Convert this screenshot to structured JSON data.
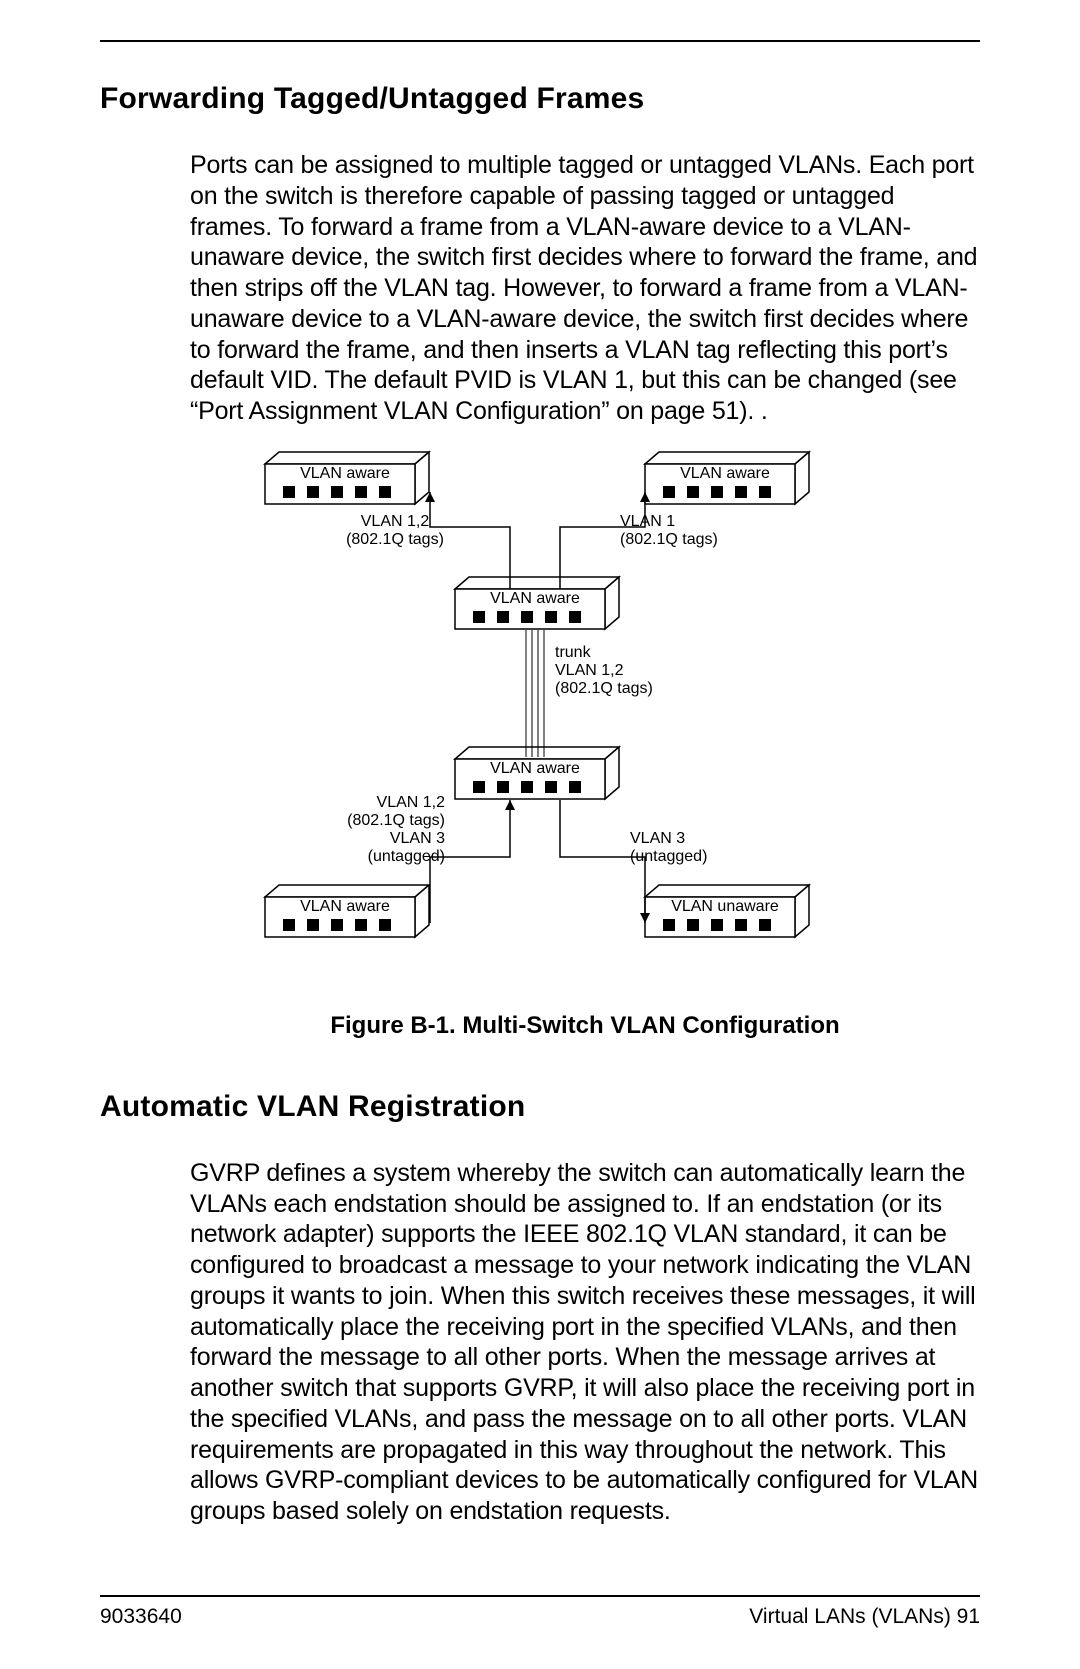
{
  "section1": {
    "heading": "Forwarding Tagged/Untagged Frames",
    "body": "Ports can be assigned to multiple tagged or untagged VLANs. Each port on the switch is therefore capable of passing tagged or untagged frames. To forward a frame from a VLAN-aware device to a VLAN-unaware device, the switch first decides where to forward the frame, and then strips off the VLAN tag. However, to forward a frame from a VLAN-unaware device to a VLAN-aware device, the switch first decides where to forward the frame, and then inserts a VLAN tag reflecting this port’s default VID. The default PVID is VLAN 1, but this can be changed (see “Port Assignment VLAN Configuration” on page 51). ."
  },
  "diagram": {
    "labels": {
      "sw_top_left": "VLAN aware",
      "sw_top_right": "VLAN aware",
      "sw_mid": "VLAN aware",
      "sw_mid2": "VLAN aware",
      "sw_bot_left": "VLAN aware",
      "sw_bot_right": "VLAN unaware",
      "link_tl_1": "VLAN 1,2",
      "link_tl_2": "(802.1Q tags)",
      "link_tr_1": "VLAN 1",
      "link_tr_2": "(802.1Q tags)",
      "trunk_1": "trunk",
      "trunk_2": "VLAN 1,2",
      "trunk_3": "(802.1Q tags)",
      "link_bl_1": "VLAN 1,2",
      "link_bl_2": "(802.1Q tags)",
      "link_bl_3": "VLAN 3",
      "link_bl_4": "(untagged)",
      "link_br_1": "VLAN 3",
      "link_br_2": "(untagged)"
    },
    "caption": "Figure B-1. Multi-Switch VLAN Configuration"
  },
  "section2": {
    "heading": "Automatic VLAN Registration",
    "body": "GVRP defines a system whereby the switch can automatically learn the VLANs each endstation should be assigned to. If an endstation (or its network adapter) supports the IEEE 802.1Q VLAN standard, it can be configured to broadcast a message to your network indicating the VLAN groups it wants to join. When this switch receives these messages, it will automatically place the receiving port in the specified VLANs, and then forward the message to all other ports. When the message arrives at another switch that supports GVRP, it will also place the receiving port in the specified VLANs, and pass the message on to all other ports. VLAN requirements are propagated in this way throughout the network. This allows GVRP-compliant devices to be automatically configured for VLAN groups based solely on endstation requests."
  },
  "footer": {
    "left": "9033640",
    "right": "Virtual LANs (VLANs)  91"
  }
}
